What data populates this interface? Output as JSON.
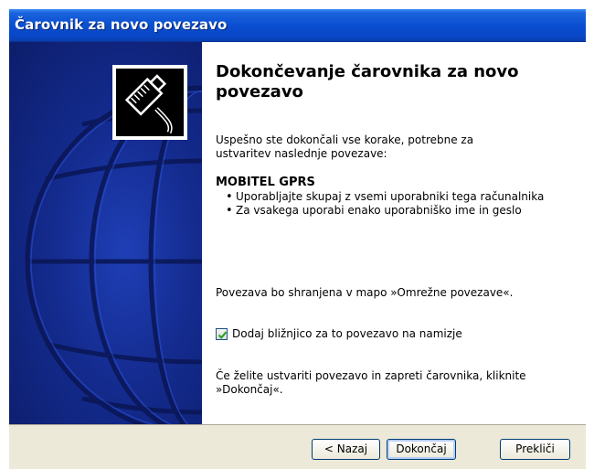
{
  "window": {
    "title": "Čarovnik za novo povezavo"
  },
  "main": {
    "heading": "Dokončevanje čarovnika za novo povezavo",
    "intro_line1": "Uspešno ste dokončali vse korake, potrebne za",
    "intro_line2": "ustvaritev naslednje povezave:",
    "connection_name": "MOBITEL GPRS",
    "bullets": [
      "Uporabljajte skupaj z vsemi uporabniki tega računalnika",
      "Za vsakega uporabi enako uporabniško ime in geslo"
    ],
    "save_info": "Povezava bo shranjena v mapo »Omrežne povezave«.",
    "shortcut_checkbox": {
      "label": "Dodaj bližnjico za to povezavo na namizje",
      "checked": true
    },
    "finish_note_line1": "Če želite ustvariti povezavo in zapreti čarovnika, kliknite",
    "finish_note_line2": "»Dokončaj«."
  },
  "buttons": {
    "back": "< Nazaj",
    "finish": "Dokončaj",
    "cancel": "Prekliči"
  },
  "icons": {
    "wizard": "network-cable-icon",
    "checkbox": "checkmark-icon"
  },
  "colors": {
    "titlebar": "#0a4fd1",
    "left_panel": "#142b8e",
    "button_bar": "#ece9d8"
  }
}
